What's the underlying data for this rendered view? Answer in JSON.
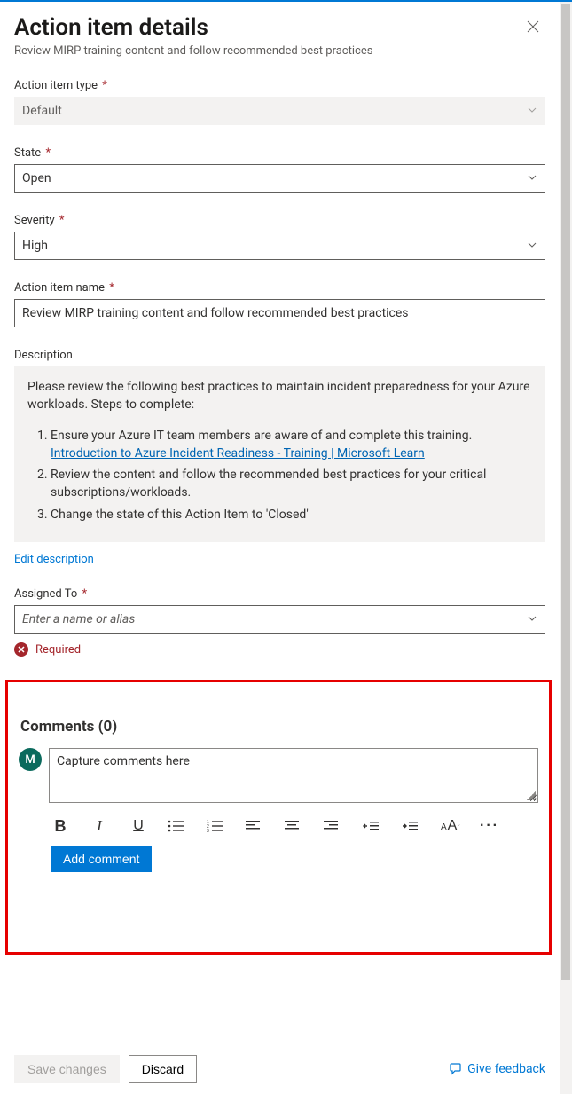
{
  "header": {
    "title": "Action item details",
    "subtitle": "Review MIRP training content and follow recommended best practices"
  },
  "fields": {
    "type_label": "Action item type",
    "type_value": "Default",
    "state_label": "State",
    "state_value": "Open",
    "severity_label": "Severity",
    "severity_value": "High",
    "name_label": "Action item name",
    "name_value": "Review MIRP training content and follow recommended best practices",
    "desc_label": "Description",
    "desc_intro": "Please review the following best practices to maintain incident preparedness for your Azure workloads. Steps to complete:",
    "desc_step1": "Ensure your Azure IT team members are aware of and complete this training.",
    "desc_link": "Introduction to Azure Incident Readiness - Training | Microsoft Learn",
    "desc_step2": "Review the content and follow the recommended best practices for your critical subscriptions/workloads.",
    "desc_step3": "Change the state of this Action Item to 'Closed'",
    "edit_desc": "Edit description",
    "assigned_label": "Assigned To",
    "assigned_placeholder": "Enter a name or alias",
    "required_error": "Required"
  },
  "comments": {
    "title": "Comments (0)",
    "avatar_initial": "M",
    "placeholder": "Capture comments here",
    "add_button": "Add comment"
  },
  "footer": {
    "save": "Save changes",
    "discard": "Discard",
    "feedback": "Give feedback"
  }
}
